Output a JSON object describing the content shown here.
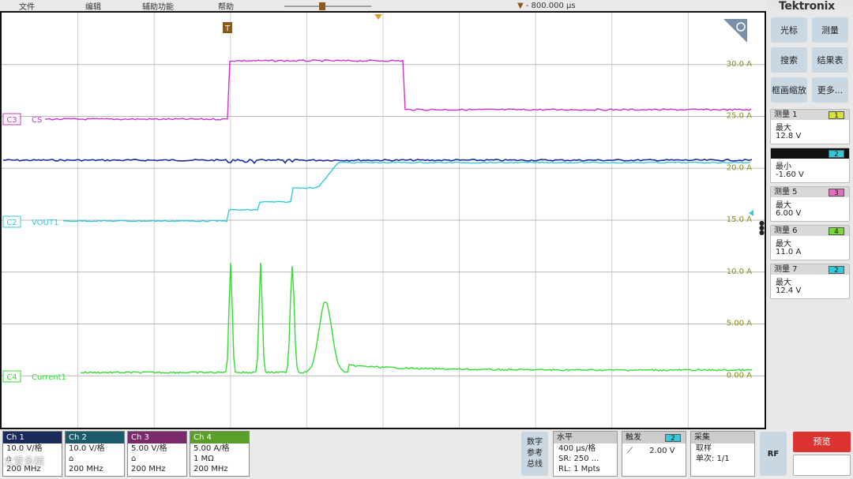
{
  "menu": {
    "file": "文件",
    "edit": "编辑",
    "utility": "辅助功能",
    "help": "帮助"
  },
  "header": {
    "trigger_delay": "- 800.000 µs"
  },
  "brand": "Tektronix",
  "scope": {
    "trigger_marker": "T",
    "right_labels": [
      "30.0 A",
      "25.0 A",
      "20.0 A",
      "15.0 A",
      "10.0 A",
      "5.00 A",
      "0.00 A"
    ],
    "channels": {
      "c3": {
        "tag": "C3",
        "label": "CS",
        "color": "#cc33cc"
      },
      "c2": {
        "tag": "C2",
        "label": "VOUT1",
        "color": "#33c8dc"
      },
      "c4": {
        "tag": "C4",
        "label": "Current1",
        "color": "#33dd33"
      },
      "c1": {
        "color": "#1a2a9a"
      }
    }
  },
  "right_panel": {
    "buttons": {
      "cursor": "光标",
      "measure": "测量",
      "search": "搜索",
      "results": "结果表",
      "zoom": "框画缩放",
      "more": "更多..."
    },
    "measurements": [
      {
        "title": "测量 1",
        "badge": "1",
        "badge_color": "#d6e03a",
        "type": "最大",
        "value": "12.8 V",
        "dark": false
      },
      {
        "title": "",
        "badge": "2",
        "badge_color": "#33c8dc",
        "type": "最小",
        "value": "-1.60 V",
        "dark": true
      },
      {
        "title": "测量 5",
        "badge": "3",
        "badge_color": "#e070b8",
        "type": "最大",
        "value": "6.00 V",
        "dark": false
      },
      {
        "title": "测量 6",
        "badge": "4",
        "badge_color": "#7ad63a",
        "type": "最大",
        "value": "11.0 A",
        "dark": false
      },
      {
        "title": "测量 7",
        "badge": "2",
        "badge_color": "#33c8dc",
        "type": "最大",
        "value": "12.4 V",
        "dark": false
      }
    ]
  },
  "bottom": {
    "channels": [
      {
        "name": "Ch 1",
        "color": "#1a2a5a",
        "scale": "10.0 V/格",
        "coupling": "",
        "bw": "200 MHz"
      },
      {
        "name": "Ch 2",
        "color": "#1a5a6a",
        "scale": "10.0 V/格",
        "coupling": "",
        "bw": "200 MHz"
      },
      {
        "name": "Ch 3",
        "color": "#7a2a6a",
        "scale": "5.00 V/格",
        "coupling": "",
        "bw": "200 MHz"
      },
      {
        "name": "Ch 4",
        "color": "#5aa028",
        "scale": "5.00 A/格",
        "coupling": "1 MΩ",
        "bw": "200 MHz"
      }
    ],
    "arith": "数字参考总线",
    "horizontal": {
      "title": "水平",
      "scale": "400 µs/格",
      "sr": "SR: 250 ...",
      "rl": "RL: 1 Mpts"
    },
    "trigger": {
      "title": "触发",
      "badge": "2",
      "level": "2.00 V"
    },
    "acquire": {
      "title": "采集",
      "mode": "取样",
      "count": "单次: 1/1"
    },
    "rf": "RF",
    "preview": "预览"
  },
  "watermark": "大爱多精"
}
